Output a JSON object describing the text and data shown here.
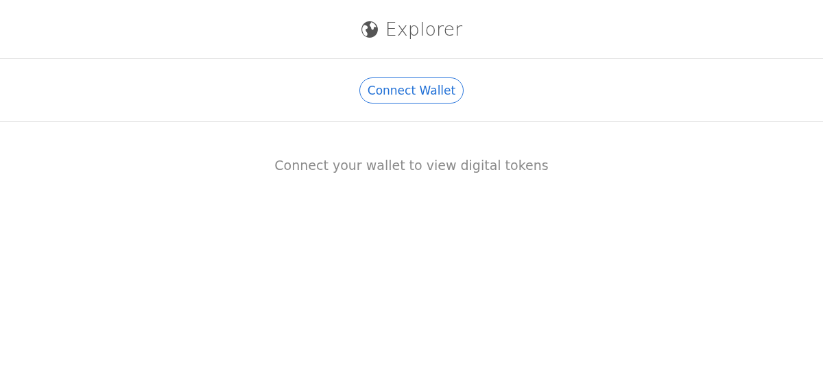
{
  "header": {
    "title": "Explorer"
  },
  "toolbar": {
    "button": "Connect Wallet"
  },
  "empty_state": {
    "message": "Connect your wallet to view digital tokens"
  }
}
